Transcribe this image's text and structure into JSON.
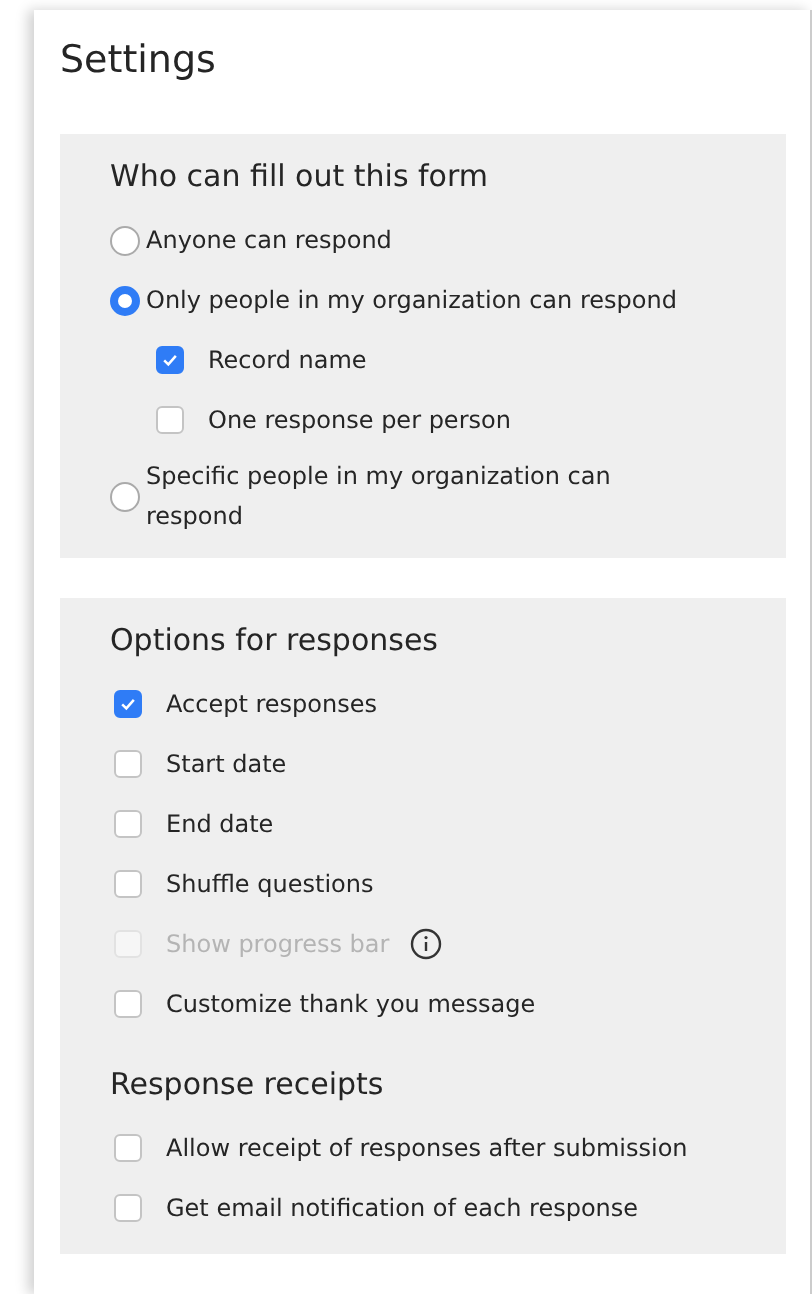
{
  "title": "Settings",
  "panels": [
    {
      "groups": [
        {
          "heading": "Who can fill out this form",
          "items": [
            {
              "kind": "radio",
              "label": "Anyone can respond",
              "selected": false
            },
            {
              "kind": "radio",
              "label": "Only people in my organization can respond",
              "selected": true,
              "children": [
                {
                  "kind": "checkbox",
                  "label": "Record name",
                  "checked": true
                },
                {
                  "kind": "checkbox",
                  "label": "One response per person",
                  "checked": false
                }
              ]
            },
            {
              "kind": "radio",
              "label": "Specific people in my organization can respond",
              "selected": false
            }
          ]
        }
      ]
    },
    {
      "groups": [
        {
          "heading": "Options for responses",
          "items": [
            {
              "kind": "checkbox",
              "label": "Accept responses",
              "checked": true
            },
            {
              "kind": "checkbox",
              "label": "Start date",
              "checked": false
            },
            {
              "kind": "checkbox",
              "label": "End date",
              "checked": false
            },
            {
              "kind": "checkbox",
              "label": "Shuffle questions",
              "checked": false
            },
            {
              "kind": "checkbox",
              "label": "Show progress bar",
              "checked": false,
              "disabled": true,
              "info": true
            },
            {
              "kind": "checkbox",
              "label": "Customize thank you message",
              "checked": false
            }
          ]
        },
        {
          "heading": "Response receipts",
          "items": [
            {
              "kind": "checkbox",
              "label": "Allow receipt of responses after submission",
              "checked": false
            },
            {
              "kind": "checkbox",
              "label": "Get email notification of each response",
              "checked": false
            }
          ]
        }
      ]
    }
  ]
}
